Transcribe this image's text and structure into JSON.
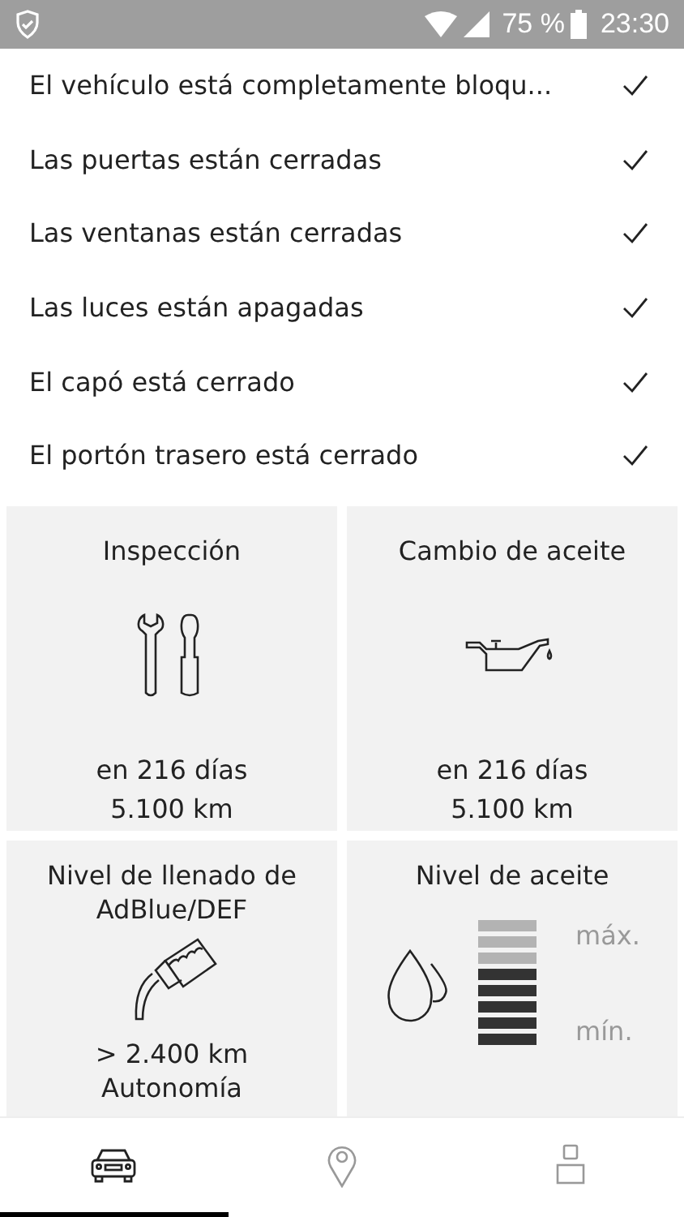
{
  "status_bar": {
    "battery": "75 %",
    "time": "23:30"
  },
  "checks": [
    {
      "label": "El vehículo está completamente bloqu...",
      "checked": true
    },
    {
      "label": "Las puertas están cerradas",
      "checked": true
    },
    {
      "label": "Las ventanas están cerradas",
      "checked": true
    },
    {
      "label": "Las luces están apagadas",
      "checked": true
    },
    {
      "label": "El capó está cerrado",
      "checked": true
    },
    {
      "label": "El portón trasero está cerrado",
      "checked": true
    }
  ],
  "cards": [
    {
      "kind": "inspection",
      "title": "Inspección",
      "lines": [
        "en 216 días",
        "5.100 km"
      ]
    },
    {
      "kind": "oil_change",
      "title": "Cambio de aceite",
      "lines": [
        "en 216 días",
        "5.100 km"
      ]
    },
    {
      "kind": "adblue",
      "title": "Nivel de llenado de AdBlue/DEF",
      "lines": [
        "> 2.400 km",
        "Autonomía"
      ]
    },
    {
      "kind": "oil_level",
      "title": "Nivel de aceite",
      "level": 0.625,
      "max_label": "máx.",
      "min_label": "mín."
    }
  ],
  "tabs": [
    {
      "kind": "car",
      "selected": true
    },
    {
      "kind": "location",
      "selected": false
    },
    {
      "kind": "profile",
      "selected": false
    }
  ]
}
